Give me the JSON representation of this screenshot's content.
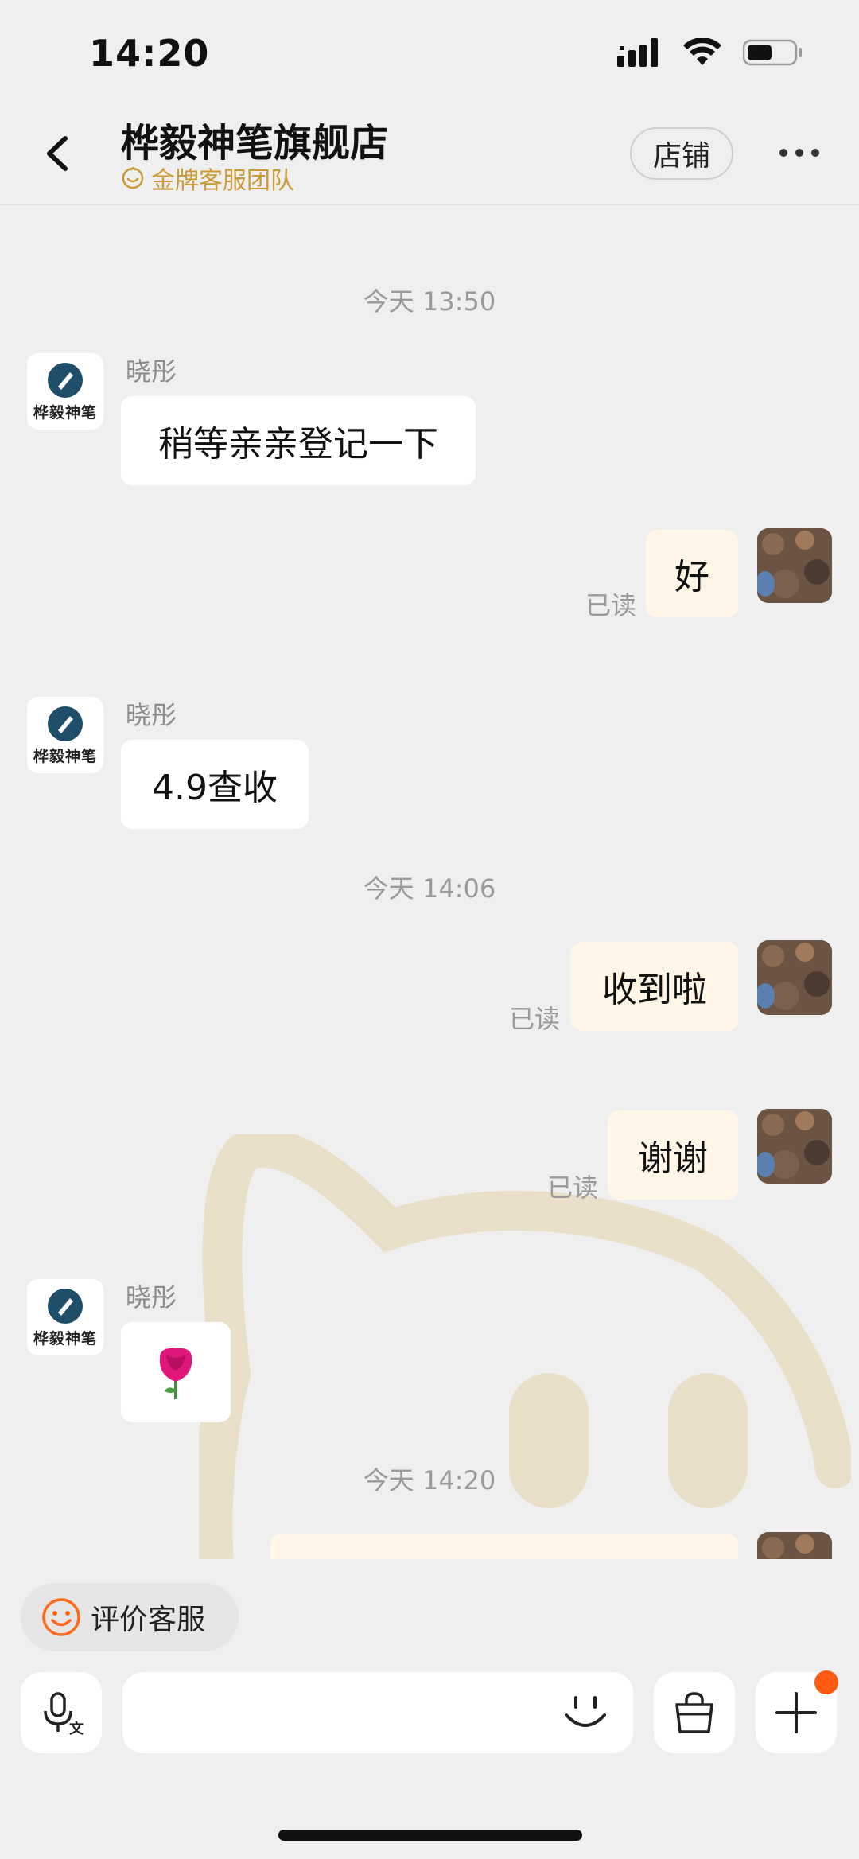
{
  "status_bar": {
    "time": "14:20"
  },
  "header": {
    "shop_name": "桦毅神笔旗舰店",
    "team_label": "金牌客服团队",
    "store_button": "店铺",
    "accent_color": "#c99a35"
  },
  "shop_avatar": {
    "logo_text": "桦毅神笔"
  },
  "messages": {
    "ts1": "今天 13:50",
    "m1": {
      "sender": "晓彤",
      "text": "稍等亲亲登记一下"
    },
    "m2": {
      "text": "好",
      "read": "已读"
    },
    "m3": {
      "sender": "晓彤",
      "text": "4.9查收"
    },
    "ts2": "今天 14:06",
    "m4": {
      "text": "收到啦",
      "read": "已读"
    },
    "m5": {
      "text": "谢谢",
      "read": "已读"
    },
    "m6": {
      "sender": "晓彤",
      "sticker": "rose-icon"
    },
    "ts3": "今天 14:20"
  },
  "footer": {
    "rate_button": "评价客服",
    "input_placeholder": "",
    "notification_color": "#ff5a12"
  }
}
